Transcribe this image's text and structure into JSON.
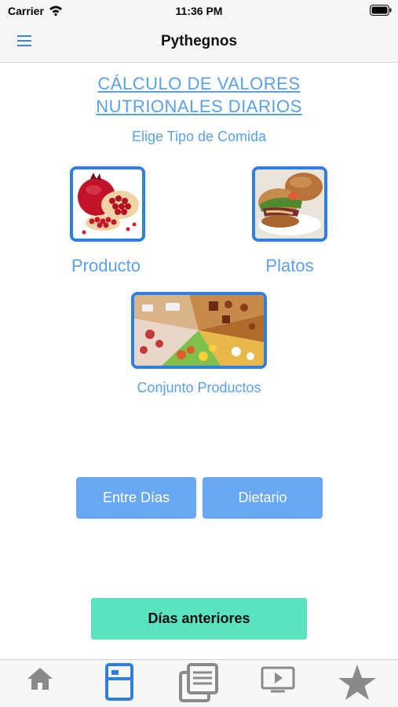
{
  "status_bar": {
    "carrier": "Carrier",
    "time": "11:36 PM"
  },
  "nav": {
    "title": "Pythegnos",
    "menu_icon": "hamburger-menu-icon"
  },
  "main": {
    "title_line1": "CÁLCULO DE VALORES",
    "title_line2": "NUTRIONALES DIARIOS",
    "subtitle": "Elige Tipo de Comida",
    "options": [
      {
        "label": "Producto",
        "image": "pomegranate-image"
      },
      {
        "label": "Platos",
        "image": "burger-image"
      },
      {
        "label": "Conjunto Productos",
        "image": "assorted-foods-image"
      }
    ],
    "buttons": {
      "entre_dias": "Entre Días",
      "dietario": "Dietario",
      "dias_anteriores": "Días anteriores"
    }
  },
  "tab_bar": {
    "items": [
      {
        "icon": "home-icon",
        "active": false
      },
      {
        "icon": "calculator-icon",
        "active": true
      },
      {
        "icon": "documents-icon",
        "active": false
      },
      {
        "icon": "video-player-icon",
        "active": false
      },
      {
        "icon": "star-icon",
        "active": false
      }
    ]
  },
  "colors": {
    "accent": "#2f7fe0",
    "label": "#5aa0ea",
    "button": "#6aa8f1",
    "green_button": "#5be2bf",
    "tab_inactive": "#8a8a8a"
  }
}
